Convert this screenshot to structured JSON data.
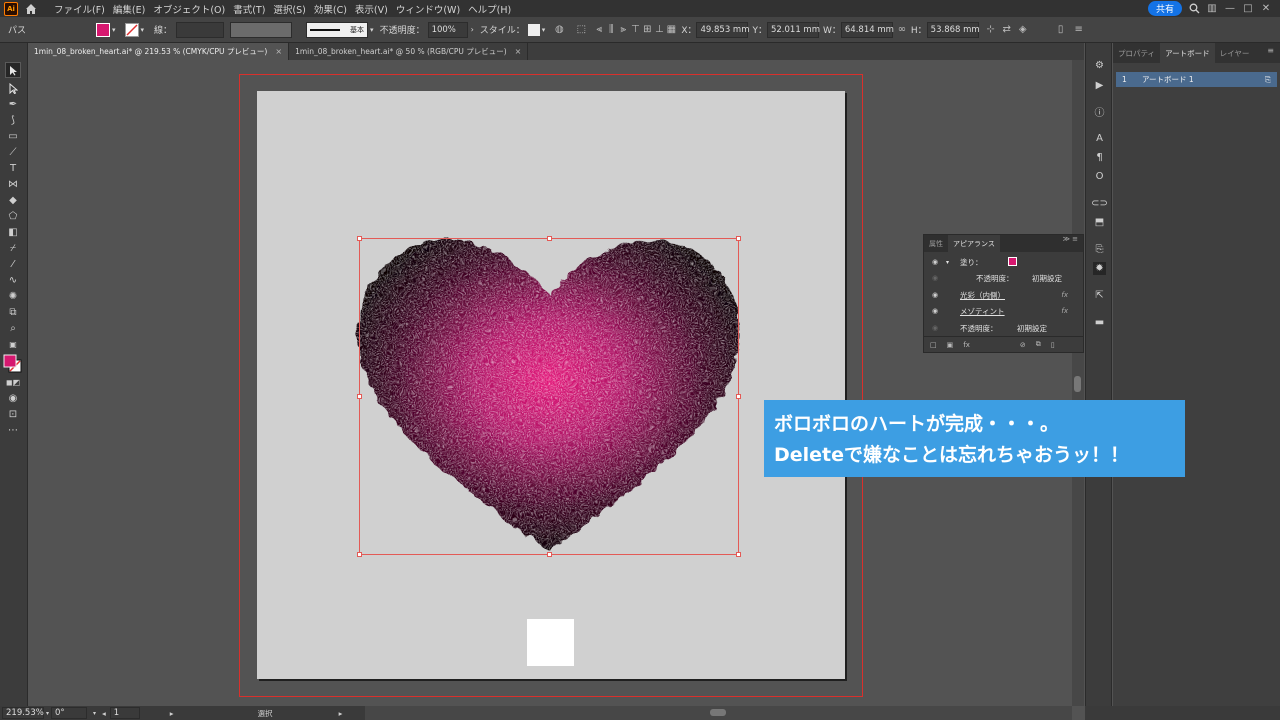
{
  "menubar": {
    "app_logo": "Ai",
    "items": [
      "ファイル(F)",
      "編集(E)",
      "オブジェクト(O)",
      "書式(T)",
      "選択(S)",
      "効果(C)",
      "表示(V)",
      "ウィンドウ(W)",
      "ヘルプ(H)"
    ],
    "share_label": "共有"
  },
  "controlbar": {
    "selection_type": "パス",
    "fill_color": "#d6186f",
    "stroke_label": "線：",
    "stroke_style_label": "基本",
    "opacity_label": "不透明度：",
    "opacity_value": "100%",
    "style_label": "スタイル：",
    "x_label": "X：",
    "x_value": "49.853 mm",
    "y_label": "Y：",
    "y_value": "52.011 mm",
    "w_label": "W：",
    "w_value": "64.814 mm",
    "h_label": "H：",
    "h_value": "53.868 mm"
  },
  "tabs": [
    {
      "label": "1min_08_broken_heart.ai* @ 219.53 % (CMYK/CPU プレビュー)",
      "close": "×"
    },
    {
      "label": "1min_08_broken_heart.ai* @ 50 % (RGB/CPU プレビュー)",
      "close": "×"
    }
  ],
  "right_panel": {
    "tabs": [
      "プロパティ",
      "アートボード",
      "レイヤー"
    ],
    "row_index": "1",
    "row_label": "アートボード 1"
  },
  "appearance": {
    "tabs": [
      "属性",
      "アピアランス"
    ],
    "rows": [
      {
        "label": "塗り：",
        "value": ""
      },
      {
        "label": "不透明度：",
        "value": "初期設定"
      },
      {
        "label": "光彩（内側）",
        "value": ""
      },
      {
        "label": "メゾティント",
        "value": ""
      },
      {
        "label": "不透明度：",
        "value": "初期設定"
      }
    ],
    "fx_symbol": "fx"
  },
  "caption": {
    "line1": "ボロボロのハートが完成・・・。",
    "line2": "Deleteで嫌なことは忘れちゃおうッ！！",
    "background": "#3d9ee3"
  },
  "statusbar": {
    "zoom": "219.53%",
    "rotation": "0°",
    "artboard_no": "1",
    "tool": "選択"
  },
  "colors": {
    "heart_center": "#e3197a",
    "heart_edge": "#0a0004",
    "bleed_guide": "#d9302c"
  }
}
